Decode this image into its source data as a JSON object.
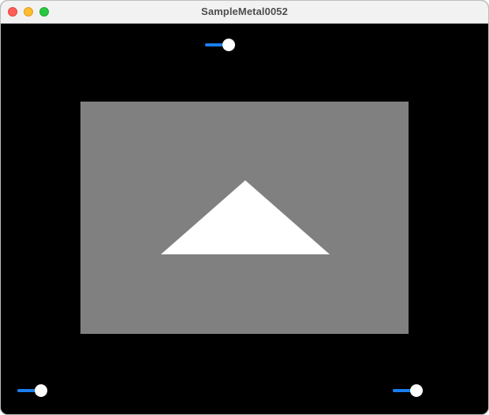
{
  "window": {
    "title": "SampleMetal0052",
    "buttons": [
      {
        "name": "close",
        "color": "#fe5f57",
        "border": "#e1463f"
      },
      {
        "name": "minimize",
        "color": "#febc2e",
        "border": "#dfa023"
      },
      {
        "name": "zoom",
        "color": "#28c840",
        "border": "#1fa833"
      }
    ]
  },
  "colors": {
    "background": "#000000",
    "viewport": "#808080",
    "triangle": "#ffffff",
    "slider_accent": "#1a7ff0"
  },
  "sliders": [
    {
      "name": "top-slider",
      "value": 1.0
    },
    {
      "name": "bottom-left-slider",
      "value": 1.0
    },
    {
      "name": "bottom-right-slider",
      "value": 1.0
    }
  ]
}
